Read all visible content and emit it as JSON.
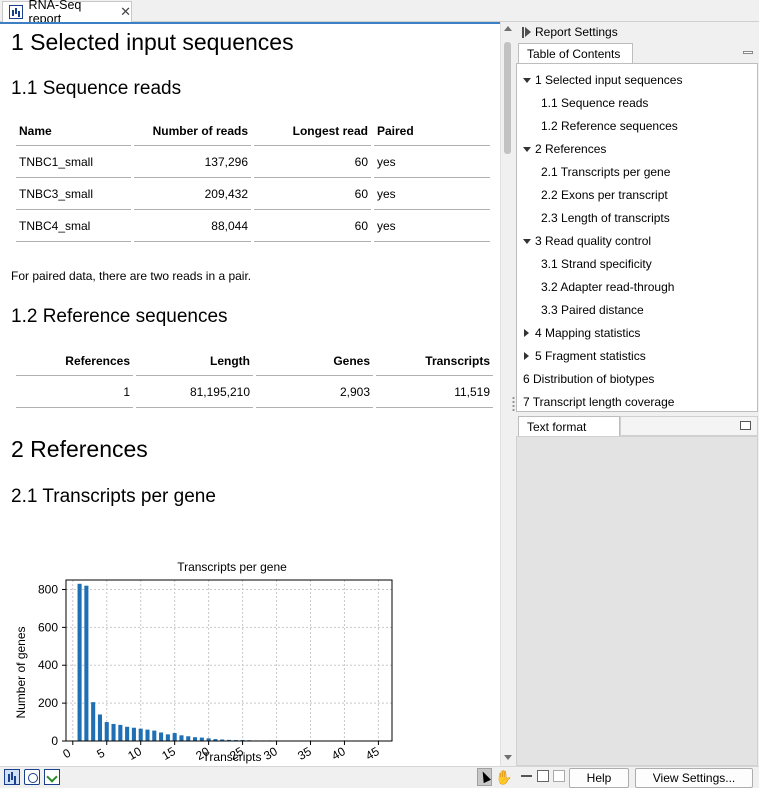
{
  "tab": {
    "title": "RNA-Seq report",
    "close": "✕"
  },
  "report": {
    "h1_input": "1 Selected input sequences",
    "h2_reads": "1.1 Sequence reads",
    "reads_table": {
      "headers": [
        "Name",
        "Number of reads",
        "Longest read",
        "Paired"
      ],
      "rows": [
        [
          "TNBC1_small",
          "137,296",
          "60",
          "yes"
        ],
        [
          "TNBC3_small",
          "209,432",
          "60",
          "yes"
        ],
        [
          "TNBC4_smal",
          "88,044",
          "60",
          "yes"
        ]
      ]
    },
    "paired_note": "For paired data, there are two reads in a pair.",
    "h2_refs": "1.2 Reference sequences",
    "refs_table": {
      "headers": [
        "References",
        "Length",
        "Genes",
        "Transcripts"
      ],
      "rows": [
        [
          "1",
          "81,195,210",
          "2,903",
          "11,519"
        ]
      ]
    },
    "h1_references": "2 References",
    "h2_transcripts": "2.1 Transcripts per gene"
  },
  "chart_data": {
    "type": "bar",
    "title": "Transcripts per gene",
    "xlabel": "Transcripts",
    "ylabel": "Number of genes",
    "xlim": [
      -1,
      47
    ],
    "ylim": [
      0,
      850
    ],
    "xticks": [
      0,
      5,
      10,
      15,
      20,
      25,
      30,
      35,
      40,
      45
    ],
    "yticks": [
      0,
      200,
      400,
      600,
      800
    ],
    "grid": true,
    "color": "#1f6fb5",
    "x": [
      1,
      2,
      3,
      4,
      5,
      6,
      7,
      8,
      9,
      10,
      11,
      12,
      13,
      14,
      15,
      16,
      17,
      18,
      19,
      20,
      21,
      22,
      23,
      24,
      25,
      26,
      27,
      28,
      29,
      30,
      31
    ],
    "values": [
      830,
      820,
      205,
      140,
      100,
      90,
      85,
      75,
      70,
      65,
      60,
      55,
      45,
      35,
      42,
      30,
      25,
      20,
      18,
      14,
      10,
      8,
      6,
      5,
      5,
      4,
      3,
      3,
      3,
      2,
      2
    ]
  },
  "right_panel": {
    "report_settings": "Report Settings",
    "toc_tab": "Table of Contents",
    "toc": [
      {
        "label": "1 Selected input sequences",
        "level": 0,
        "toggle": "expanded"
      },
      {
        "label": "1.1 Sequence reads",
        "level": 1
      },
      {
        "label": "1.2 Reference sequences",
        "level": 1
      },
      {
        "label": "2 References",
        "level": 0,
        "toggle": "expanded"
      },
      {
        "label": "2.1 Transcripts per gene",
        "level": 1
      },
      {
        "label": "2.2 Exons per transcript",
        "level": 1
      },
      {
        "label": "2.3 Length of transcripts",
        "level": 1
      },
      {
        "label": "3 Read quality control",
        "level": 0,
        "toggle": "expanded"
      },
      {
        "label": "3.1 Strand specificity",
        "level": 1
      },
      {
        "label": "3.2 Adapter read-through",
        "level": 1
      },
      {
        "label": "3.3 Paired distance",
        "level": 1
      },
      {
        "label": "4 Mapping statistics",
        "level": 0,
        "toggle": "collapsed"
      },
      {
        "label": "5 Fragment statistics",
        "level": 0,
        "toggle": "collapsed"
      },
      {
        "label": "6 Distribution of biotypes",
        "level": 0,
        "toggle": "none"
      },
      {
        "label": "7 Transcript length coverage",
        "level": 0,
        "toggle": "none"
      }
    ],
    "text_format_tab": "Text format"
  },
  "bottom": {
    "help": "Help",
    "view_settings": "View Settings...",
    "hand": "✋"
  }
}
